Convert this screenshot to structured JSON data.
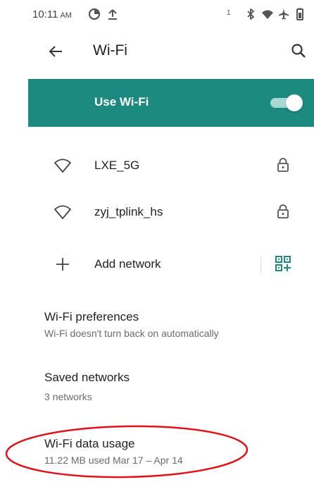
{
  "status_bar": {
    "time": "10:11",
    "ampm": "AM",
    "badge": "1"
  },
  "app_bar": {
    "title": "Wi-Fi"
  },
  "master_switch": {
    "label": "Use Wi-Fi",
    "on": true
  },
  "networks": [
    {
      "name": "LXE_5G",
      "secured": true
    },
    {
      "name": "zyj_tplink_hs",
      "secured": true
    }
  ],
  "add_network": {
    "label": "Add network"
  },
  "preferences": [
    {
      "title": "Wi-Fi preferences",
      "summary": "Wi-Fi doesn't turn back on automatically"
    },
    {
      "title": "Saved networks",
      "summary": "3 networks"
    },
    {
      "title": "Wi-Fi data usage",
      "summary": "11.22 MB used Mar 17 – Apr 14"
    }
  ],
  "colors": {
    "accent": "#1c8a7e",
    "highlight": "#e0121a"
  }
}
